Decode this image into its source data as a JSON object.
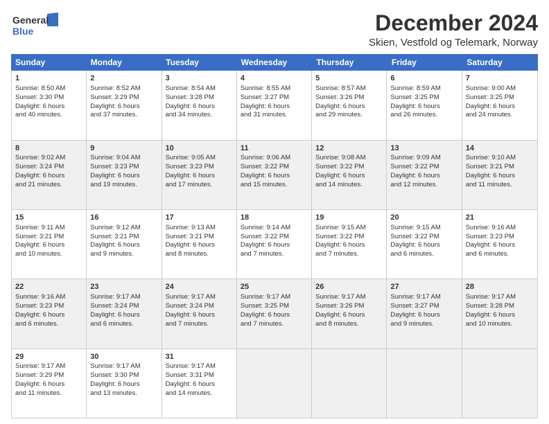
{
  "logo": {
    "line1": "General",
    "line2": "Blue"
  },
  "title": "December 2024",
  "subtitle": "Skien, Vestfold og Telemark, Norway",
  "weekdays": [
    "Sunday",
    "Monday",
    "Tuesday",
    "Wednesday",
    "Thursday",
    "Friday",
    "Saturday"
  ],
  "weeks": [
    [
      {
        "day": "1",
        "lines": [
          "Sunrise: 8:50 AM",
          "Sunset: 3:30 PM",
          "Daylight: 6 hours",
          "and 40 minutes."
        ],
        "shaded": false
      },
      {
        "day": "2",
        "lines": [
          "Sunrise: 8:52 AM",
          "Sunset: 3:29 PM",
          "Daylight: 6 hours",
          "and 37 minutes."
        ],
        "shaded": false
      },
      {
        "day": "3",
        "lines": [
          "Sunrise: 8:54 AM",
          "Sunset: 3:28 PM",
          "Daylight: 6 hours",
          "and 34 minutes."
        ],
        "shaded": false
      },
      {
        "day": "4",
        "lines": [
          "Sunrise: 8:55 AM",
          "Sunset: 3:27 PM",
          "Daylight: 6 hours",
          "and 31 minutes."
        ],
        "shaded": false
      },
      {
        "day": "5",
        "lines": [
          "Sunrise: 8:57 AM",
          "Sunset: 3:26 PM",
          "Daylight: 6 hours",
          "and 29 minutes."
        ],
        "shaded": false
      },
      {
        "day": "6",
        "lines": [
          "Sunrise: 8:59 AM",
          "Sunset: 3:25 PM",
          "Daylight: 6 hours",
          "and 26 minutes."
        ],
        "shaded": false
      },
      {
        "day": "7",
        "lines": [
          "Sunrise: 9:00 AM",
          "Sunset: 3:25 PM",
          "Daylight: 6 hours",
          "and 24 minutes."
        ],
        "shaded": false
      }
    ],
    [
      {
        "day": "8",
        "lines": [
          "Sunrise: 9:02 AM",
          "Sunset: 3:24 PM",
          "Daylight: 6 hours",
          "and 21 minutes."
        ],
        "shaded": true
      },
      {
        "day": "9",
        "lines": [
          "Sunrise: 9:04 AM",
          "Sunset: 3:23 PM",
          "Daylight: 6 hours",
          "and 19 minutes."
        ],
        "shaded": true
      },
      {
        "day": "10",
        "lines": [
          "Sunrise: 9:05 AM",
          "Sunset: 3:23 PM",
          "Daylight: 6 hours",
          "and 17 minutes."
        ],
        "shaded": true
      },
      {
        "day": "11",
        "lines": [
          "Sunrise: 9:06 AM",
          "Sunset: 3:22 PM",
          "Daylight: 6 hours",
          "and 15 minutes."
        ],
        "shaded": true
      },
      {
        "day": "12",
        "lines": [
          "Sunrise: 9:08 AM",
          "Sunset: 3:22 PM",
          "Daylight: 6 hours",
          "and 14 minutes."
        ],
        "shaded": true
      },
      {
        "day": "13",
        "lines": [
          "Sunrise: 9:09 AM",
          "Sunset: 3:22 PM",
          "Daylight: 6 hours",
          "and 12 minutes."
        ],
        "shaded": true
      },
      {
        "day": "14",
        "lines": [
          "Sunrise: 9:10 AM",
          "Sunset: 3:21 PM",
          "Daylight: 6 hours",
          "and 11 minutes."
        ],
        "shaded": true
      }
    ],
    [
      {
        "day": "15",
        "lines": [
          "Sunrise: 9:11 AM",
          "Sunset: 3:21 PM",
          "Daylight: 6 hours",
          "and 10 minutes."
        ],
        "shaded": false
      },
      {
        "day": "16",
        "lines": [
          "Sunrise: 9:12 AM",
          "Sunset: 3:21 PM",
          "Daylight: 6 hours",
          "and 9 minutes."
        ],
        "shaded": false
      },
      {
        "day": "17",
        "lines": [
          "Sunrise: 9:13 AM",
          "Sunset: 3:21 PM",
          "Daylight: 6 hours",
          "and 8 minutes."
        ],
        "shaded": false
      },
      {
        "day": "18",
        "lines": [
          "Sunrise: 9:14 AM",
          "Sunset: 3:22 PM",
          "Daylight: 6 hours",
          "and 7 minutes."
        ],
        "shaded": false
      },
      {
        "day": "19",
        "lines": [
          "Sunrise: 9:15 AM",
          "Sunset: 3:22 PM",
          "Daylight: 6 hours",
          "and 7 minutes."
        ],
        "shaded": false
      },
      {
        "day": "20",
        "lines": [
          "Sunrise: 9:15 AM",
          "Sunset: 3:22 PM",
          "Daylight: 6 hours",
          "and 6 minutes."
        ],
        "shaded": false
      },
      {
        "day": "21",
        "lines": [
          "Sunrise: 9:16 AM",
          "Sunset: 3:23 PM",
          "Daylight: 6 hours",
          "and 6 minutes."
        ],
        "shaded": false
      }
    ],
    [
      {
        "day": "22",
        "lines": [
          "Sunrise: 9:16 AM",
          "Sunset: 3:23 PM",
          "Daylight: 6 hours",
          "and 6 minutes."
        ],
        "shaded": true
      },
      {
        "day": "23",
        "lines": [
          "Sunrise: 9:17 AM",
          "Sunset: 3:24 PM",
          "Daylight: 6 hours",
          "and 6 minutes."
        ],
        "shaded": true
      },
      {
        "day": "24",
        "lines": [
          "Sunrise: 9:17 AM",
          "Sunset: 3:24 PM",
          "Daylight: 6 hours",
          "and 7 minutes."
        ],
        "shaded": true
      },
      {
        "day": "25",
        "lines": [
          "Sunrise: 9:17 AM",
          "Sunset: 3:25 PM",
          "Daylight: 6 hours",
          "and 7 minutes."
        ],
        "shaded": true
      },
      {
        "day": "26",
        "lines": [
          "Sunrise: 9:17 AM",
          "Sunset: 3:26 PM",
          "Daylight: 6 hours",
          "and 8 minutes."
        ],
        "shaded": true
      },
      {
        "day": "27",
        "lines": [
          "Sunrise: 9:17 AM",
          "Sunset: 3:27 PM",
          "Daylight: 6 hours",
          "and 9 minutes."
        ],
        "shaded": true
      },
      {
        "day": "28",
        "lines": [
          "Sunrise: 9:17 AM",
          "Sunset: 3:28 PM",
          "Daylight: 6 hours",
          "and 10 minutes."
        ],
        "shaded": true
      }
    ],
    [
      {
        "day": "29",
        "lines": [
          "Sunrise: 9:17 AM",
          "Sunset: 3:29 PM",
          "Daylight: 6 hours",
          "and 11 minutes."
        ],
        "shaded": false
      },
      {
        "day": "30",
        "lines": [
          "Sunrise: 9:17 AM",
          "Sunset: 3:30 PM",
          "Daylight: 6 hours",
          "and 13 minutes."
        ],
        "shaded": false
      },
      {
        "day": "31",
        "lines": [
          "Sunrise: 9:17 AM",
          "Sunset: 3:31 PM",
          "Daylight: 6 hours",
          "and 14 minutes."
        ],
        "shaded": false
      },
      {
        "day": "",
        "lines": [],
        "shaded": true,
        "empty": true
      },
      {
        "day": "",
        "lines": [],
        "shaded": true,
        "empty": true
      },
      {
        "day": "",
        "lines": [],
        "shaded": true,
        "empty": true
      },
      {
        "day": "",
        "lines": [],
        "shaded": true,
        "empty": true
      }
    ]
  ]
}
